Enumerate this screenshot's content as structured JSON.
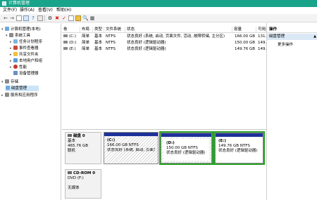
{
  "window": {
    "title": "计算机管理",
    "accent": "#18a38a"
  },
  "menu": [
    "文件(F)",
    "操作(A)",
    "查看(V)",
    "帮助(H)"
  ],
  "toolbar_icons": [
    "back-icon",
    "forward-icon",
    "up-icon",
    "properties-icon",
    "help-icon",
    "view-icon",
    "delete-icon",
    "check-icon",
    "new-icon",
    "folder-icon",
    "search-icon",
    "zoom-icon"
  ],
  "tree": [
    {
      "label": "计算机管理(本地)",
      "level": 0
    },
    {
      "label": "系统工具",
      "level": 1
    },
    {
      "label": "任务计划程序",
      "level": 2
    },
    {
      "label": "事件查看器",
      "level": 2
    },
    {
      "label": "共享文件夹",
      "level": 2
    },
    {
      "label": "本地用户和组",
      "level": 2
    },
    {
      "label": "性能",
      "level": 2
    },
    {
      "label": "设备管理器",
      "level": 2
    },
    {
      "label": "存储",
      "level": 1
    },
    {
      "label": "磁盘管理",
      "level": 2,
      "selected": true
    },
    {
      "label": "服务和应用程序",
      "level": 1
    }
  ],
  "volumes": {
    "headers": [
      "卷",
      "布局",
      "类型",
      "文件系统",
      "状态",
      "容量",
      "可用"
    ],
    "rows": [
      {
        "vol": "(C:)",
        "layout": "简单",
        "type": "基本",
        "fs": "NTFS",
        "status": "状态良好 (系统, 启动, 页面文件, 活动, 故障转储, 主分区)",
        "cap": "166.00 GB",
        "free": "131."
      },
      {
        "vol": "(D:)",
        "layout": "简单",
        "type": "基本",
        "fs": "NTFS",
        "status": "状态良好 (逻辑驱动器)",
        "cap": "150.00 GB",
        "free": "149."
      },
      {
        "vol": "(E:)",
        "layout": "简单",
        "type": "基本",
        "fs": "NTFS",
        "status": "状态良好 (逻辑驱动器)",
        "cap": "149.76 GB",
        "free": "149."
      }
    ]
  },
  "actions": {
    "header": "操作",
    "section": "磁盘管理",
    "more": "更多操作"
  },
  "disk0": {
    "name": "磁盘 0",
    "type": "基本",
    "size": "465.76 GB",
    "status": "联机",
    "partitions": [
      {
        "name": "(C:)",
        "size": "166.00 GB NTFS",
        "status": "状态良好 (系统, 启动, 页面文",
        "style": "hatched"
      },
      {
        "name": "(D:)",
        "size": "150.00 GB NTFS",
        "status": "状态良好 (逻辑驱动器)",
        "style": "selected"
      },
      {
        "name": "(E:)",
        "size": "149.76 GB NTFS",
        "status": "状态良好 (逻辑驱动器)",
        "style": "plain"
      }
    ]
  },
  "cdrom": {
    "name": "CD-ROM 0",
    "type": "DVD (F:)",
    "status": "无媒体"
  }
}
